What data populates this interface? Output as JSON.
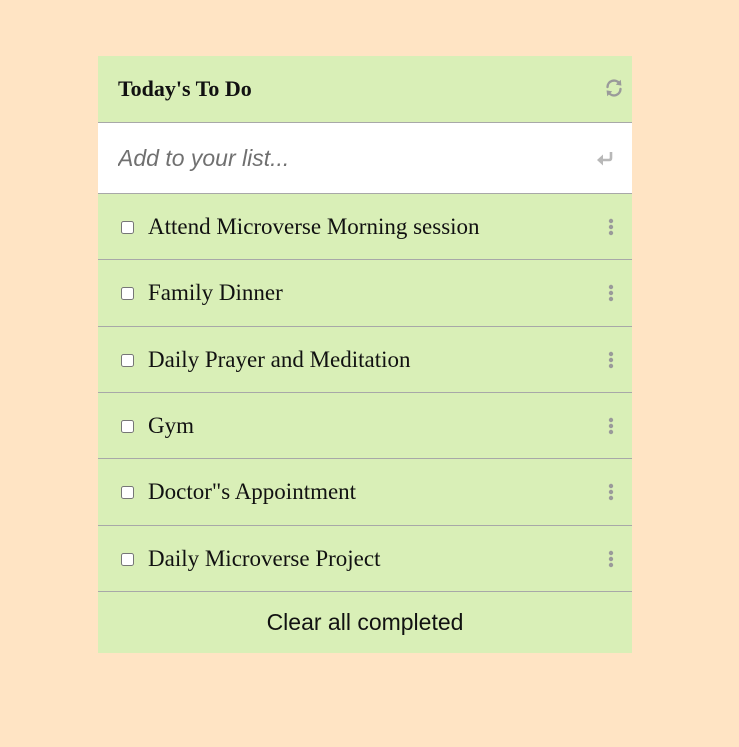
{
  "header": {
    "title": "Today's To Do",
    "refresh_icon": "refresh-icon"
  },
  "add": {
    "placeholder": "Add to your list...",
    "value": "",
    "submit_icon": "enter-icon"
  },
  "items": [
    {
      "label": "Attend Microverse Morning session",
      "completed": false
    },
    {
      "label": "Family Dinner",
      "completed": false
    },
    {
      "label": "Daily Prayer and Meditation",
      "completed": false
    },
    {
      "label": "Gym",
      "completed": false
    },
    {
      "label": "Doctor\"s Appointment",
      "completed": false
    },
    {
      "label": "Daily Microverse Project",
      "completed": false
    }
  ],
  "footer": {
    "clear_label": "Clear all completed"
  },
  "colors": {
    "page_background": "#ffe4c4",
    "card_background": "#d9efb7",
    "divider": "#a8a8a8",
    "icon": "#9a9a9a"
  }
}
